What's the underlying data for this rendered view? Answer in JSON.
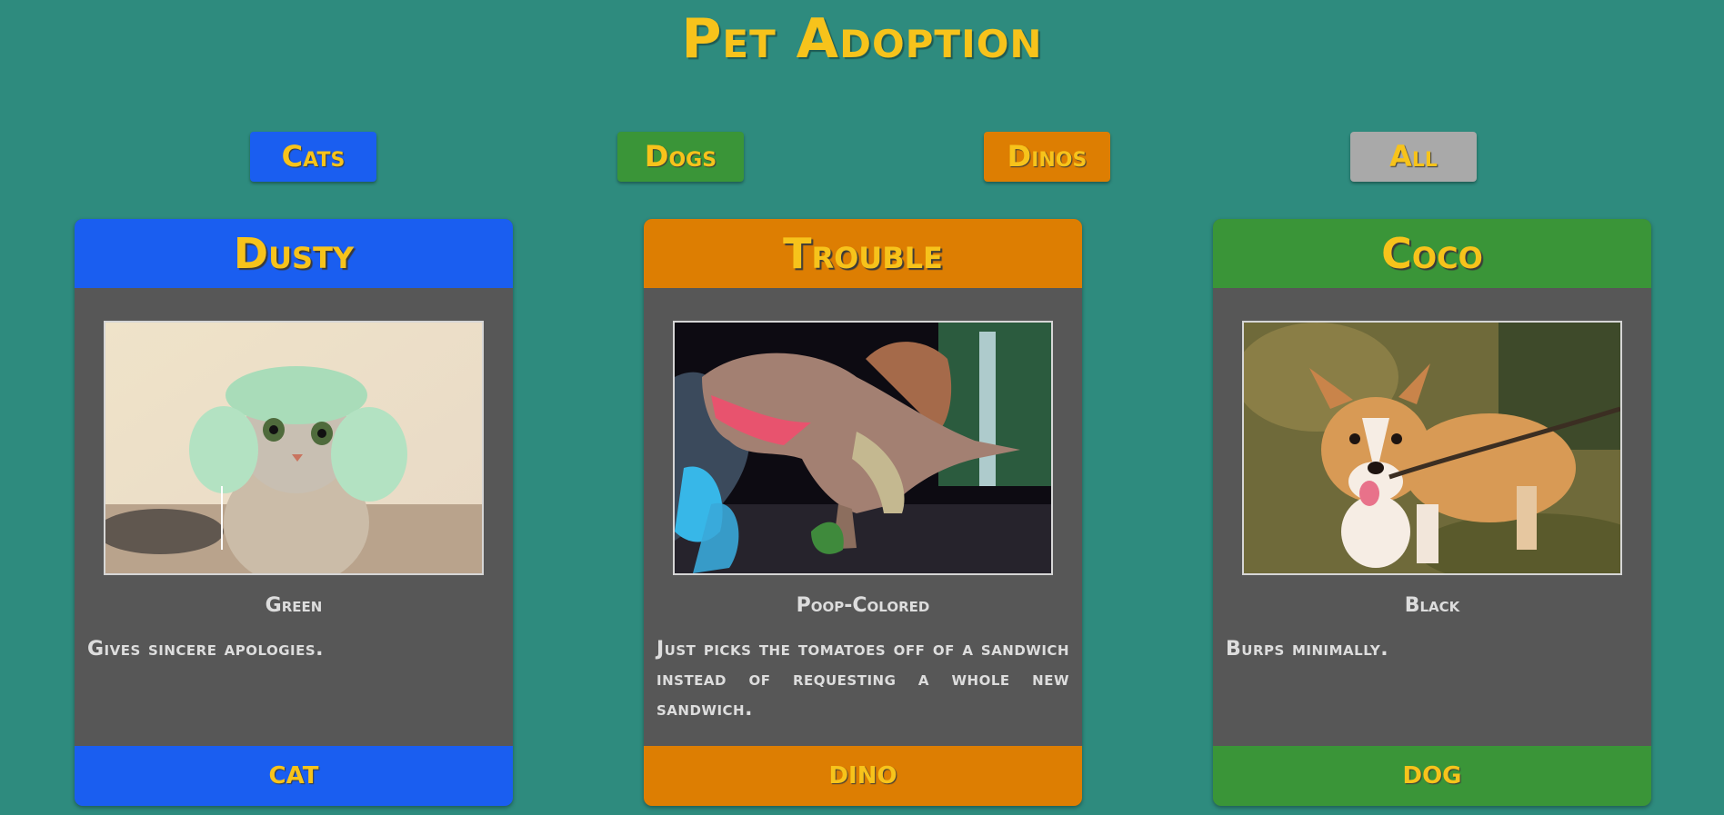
{
  "page": {
    "title": "Pet Adoption"
  },
  "filters": [
    {
      "label": "Cats",
      "color": "#1a5ef0"
    },
    {
      "label": "Dogs",
      "color": "#3a9538"
    },
    {
      "label": "Dinos",
      "color": "#dd7e02"
    },
    {
      "label": "All",
      "color": "#a9a9a9"
    }
  ],
  "cards": [
    {
      "name": "Dusty",
      "color": "Green",
      "description": "Gives sincere apologies.",
      "type": "CAT",
      "accent": "#1a5ef0",
      "photo_icon": "cat-photo"
    },
    {
      "name": "Trouble",
      "color": "Poop-Colored",
      "description": "Just picks the tomatoes off of a sandwich instead of requesting a whole new sandwich.",
      "type": "DINO",
      "accent": "#dd7e02",
      "photo_icon": "dino-photo"
    },
    {
      "name": "Coco",
      "color": "Black",
      "description": "Burps minimally.",
      "type": "DOG",
      "accent": "#3a9538",
      "photo_icon": "dog-photo"
    }
  ]
}
